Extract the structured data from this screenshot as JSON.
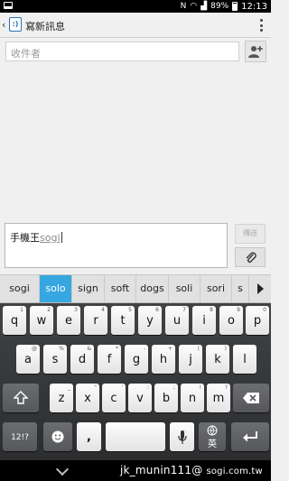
{
  "status_bar": {
    "battery": "89%",
    "time": "12:13"
  },
  "action_bar": {
    "title": "寫新訊息"
  },
  "recipient": {
    "placeholder": "收件者"
  },
  "compose": {
    "text": "手機王",
    "composing": "sogi"
  },
  "send_label": "傳送",
  "suggestions": [
    "sogi",
    "solo",
    "sign",
    "soft",
    "dogs",
    "soli",
    "sori",
    "s"
  ],
  "selected_suggestion": "solo",
  "keyboard": {
    "row1": [
      {
        "label": "q",
        "hint": "1"
      },
      {
        "label": "w",
        "hint": "2"
      },
      {
        "label": "e",
        "hint": "3"
      },
      {
        "label": "r",
        "hint": "4"
      },
      {
        "label": "t",
        "hint": "5"
      },
      {
        "label": "y",
        "hint": "6"
      },
      {
        "label": "u",
        "hint": "7"
      },
      {
        "label": "i",
        "hint": "8"
      },
      {
        "label": "o",
        "hint": "9"
      },
      {
        "label": "p",
        "hint": "0"
      }
    ],
    "row2": [
      {
        "label": "a",
        "hint": "@"
      },
      {
        "label": "s",
        "hint": "%"
      },
      {
        "label": "d",
        "hint": "&"
      },
      {
        "label": "f",
        "hint": "*"
      },
      {
        "label": "g",
        "hint": "-"
      },
      {
        "label": "h",
        "hint": "+"
      },
      {
        "label": "j",
        "hint": "("
      },
      {
        "label": "k",
        "hint": ")"
      },
      {
        "label": "l",
        "hint": ""
      }
    ],
    "row3": [
      {
        "label": "z",
        "hint": "_"
      },
      {
        "label": "x",
        "hint": "\""
      },
      {
        "label": "c",
        "hint": "'"
      },
      {
        "label": "v",
        "hint": ":"
      },
      {
        "label": "b",
        "hint": ";"
      },
      {
        "label": "n",
        "hint": "!"
      },
      {
        "label": "m",
        "hint": "?"
      }
    ],
    "symbols_key": "12!?",
    "comma_key": ",",
    "period_key": ".",
    "language_key": "英"
  },
  "watermark": {
    "user": "jk_munin111@",
    "domain": "sogi.com.tw"
  }
}
